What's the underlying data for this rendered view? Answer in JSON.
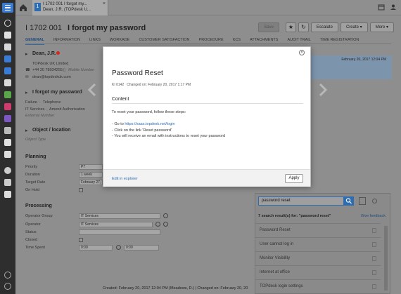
{
  "topbar": {
    "tab_line1": "I 1702 001   I forgot my...",
    "tab_line2": "Dean, J.R. (TOPdesk U..."
  },
  "header": {
    "number": "I 1702 001",
    "title": "I forgot my password",
    "save_label": "Save",
    "escalate_label": "Escalate",
    "create_label": "Create",
    "more_label": "More"
  },
  "tabs": [
    "GENERAL",
    "INFORMATION",
    "LINKS",
    "WORKADE",
    "CUSTOMER SATISFACTION",
    "PROCEDURE",
    "KCS",
    "ATTACHMENTS",
    "AUDIT TRAIL",
    "TIME REGISTRATION"
  ],
  "caller": {
    "name": "Dean, J.R.",
    "org": "TOPdesk UK Limited",
    "phone": "+44 20 78034255",
    "mobile_placeholder": "Mobile Number",
    "email": "dean@topdeskuk.com"
  },
  "request": {
    "title": "I forgot my password",
    "category": "Failure",
    "category2": "Telephone",
    "service": "IT Services",
    "service2": "Amend Authorisation",
    "external_placeholder": "External Number"
  },
  "object": {
    "title": "Object / location",
    "type_placeholder": "Object Type"
  },
  "planning": {
    "title": "Planning",
    "priority_label": "Priority",
    "priority_value": "P7",
    "duration_label": "Duration",
    "duration_value": "1 week",
    "target_label": "Target Date",
    "target_value": "February 27,",
    "onhold_label": "On Hold"
  },
  "processing": {
    "title": "Processing",
    "opgroup_label": "Operator Group",
    "opgroup_value": "IT Services",
    "operator_label": "Operator",
    "operator_value": "IT Services",
    "status_label": "Status",
    "closed_label": "Closed",
    "timespent_label": "Time Spent",
    "timespent_value": "0:00",
    "timespent_add": "0:00"
  },
  "right_panel": {
    "date": "February 20, 2017 12:04 PM"
  },
  "modal": {
    "title": "Password Reset",
    "id": "KI 0142",
    "changed": "Changed on: February 20, 2017 1:17 PM",
    "section": "Content",
    "intro": "To reset your password, follow these steps:",
    "step1_prefix": "- Go to ",
    "step1_link": "https://saas.topdesk.net/login",
    "step2": "- Click on the link 'Reset password'",
    "step3": "- You will receive an email with instructions to reset your password",
    "edit_label": "Edit in explorer",
    "apply_label": "Apply"
  },
  "search": {
    "query": "password reset",
    "results_label": "7 search result(s) for: \"password reset\"",
    "feedback_label": "Give feedback",
    "results": [
      "Password Reset",
      "User cannot log in",
      "Monitor Visibility",
      "Internet at office",
      "TOPdesk login settings"
    ]
  },
  "footer": {
    "text": "Created: February 20, 2017 12:04 PM (Meadows, D.)  |  Changed on: February 20, 20"
  },
  "colors": {
    "accent": "#2d6cae",
    "rail": "#2e2e2e",
    "overlay": "#8e8e8e",
    "caller_status": "#d9261c"
  }
}
